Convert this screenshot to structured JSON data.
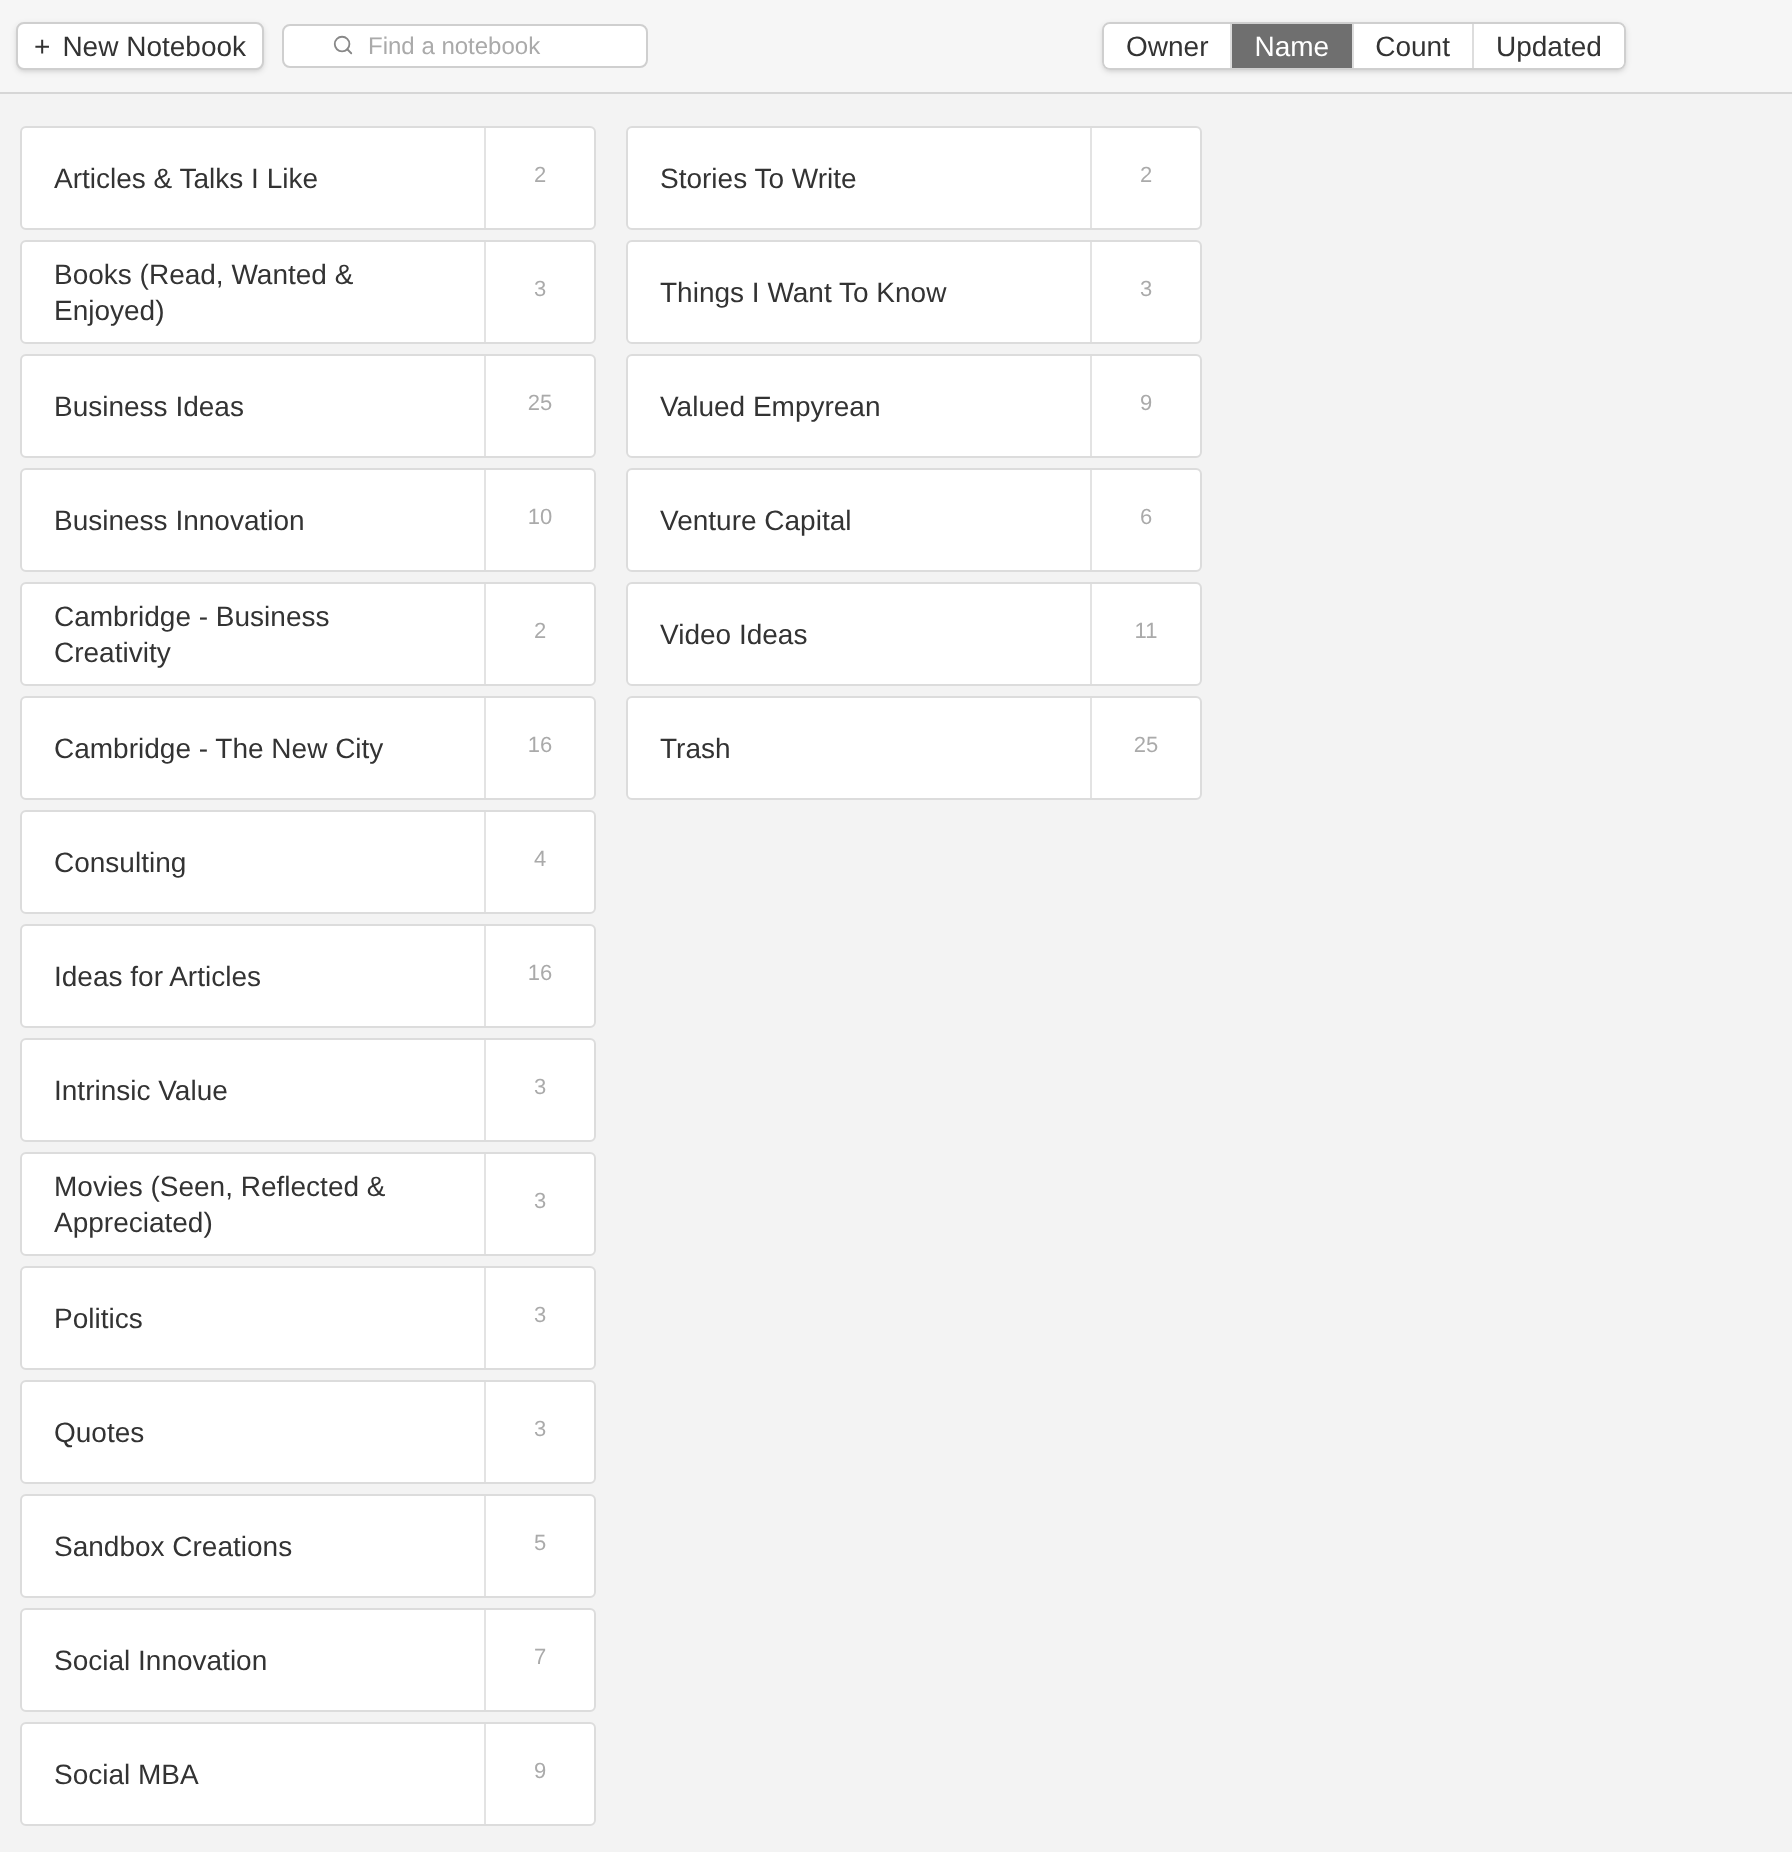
{
  "toolbar": {
    "new_button": {
      "icon": "+",
      "label": "New Notebook"
    },
    "search": {
      "placeholder": "Find a notebook"
    },
    "sort_tabs": [
      {
        "label": "Owner",
        "selected": false
      },
      {
        "label": "Name",
        "selected": true
      },
      {
        "label": "Count",
        "selected": false
      },
      {
        "label": "Updated",
        "selected": false
      }
    ]
  },
  "columns": [
    {
      "notebooks": [
        {
          "name": "Articles & Talks I Like",
          "count": "2"
        },
        {
          "name": "Books (Read, Wanted & Enjoyed)",
          "count": "3"
        },
        {
          "name": "Business Ideas",
          "count": "25"
        },
        {
          "name": "Business Innovation",
          "count": "10"
        },
        {
          "name": "Cambridge - Business Creativity",
          "count": "2"
        },
        {
          "name": "Cambridge - The New City",
          "count": "16"
        },
        {
          "name": "Consulting",
          "count": "4"
        },
        {
          "name": "Ideas for Articles",
          "count": "16"
        },
        {
          "name": "Intrinsic Value",
          "count": "3"
        },
        {
          "name": "Movies (Seen, Reflected & Appreciated)",
          "count": "3"
        },
        {
          "name": "Politics",
          "count": "3"
        },
        {
          "name": "Quotes",
          "count": "3"
        },
        {
          "name": "Sandbox Creations",
          "count": "5"
        },
        {
          "name": "Social Innovation",
          "count": "7"
        },
        {
          "name": "Social MBA",
          "count": "9"
        }
      ]
    },
    {
      "notebooks": [
        {
          "name": "Stories To Write",
          "count": "2"
        },
        {
          "name": "Things I Want To Know",
          "count": "3"
        },
        {
          "name": "Valued Empyrean",
          "count": "9"
        },
        {
          "name": "Venture Capital",
          "count": "6"
        },
        {
          "name": "Video Ideas",
          "count": "11"
        },
        {
          "name": "Trash",
          "count": "25"
        }
      ]
    }
  ]
}
